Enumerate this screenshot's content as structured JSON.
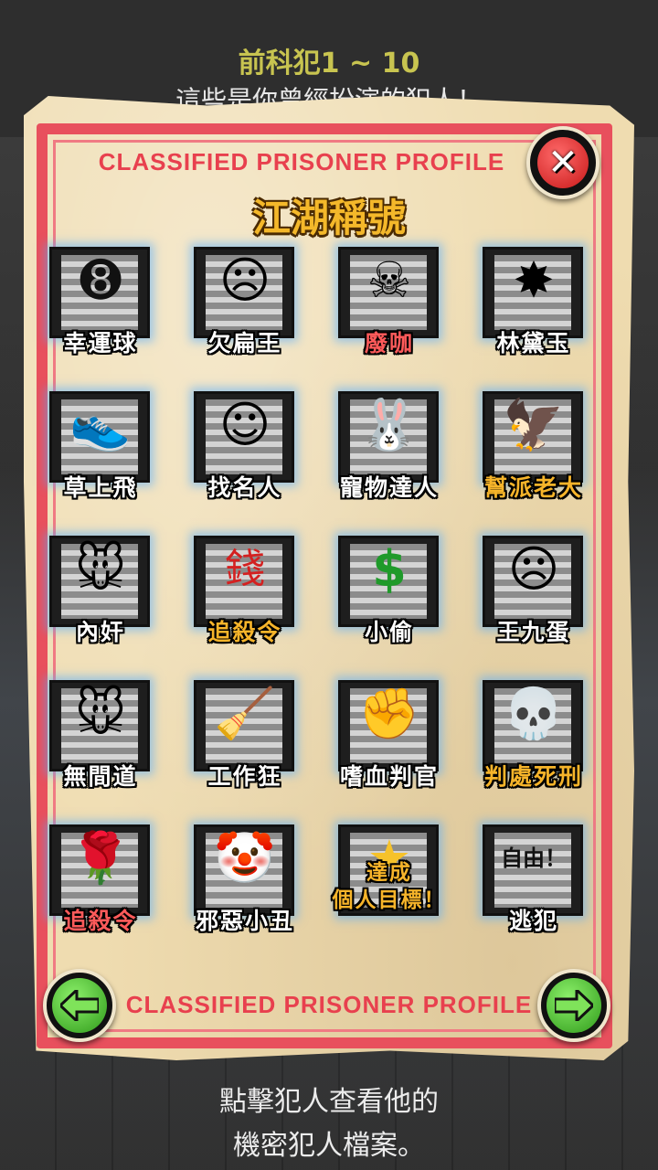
{
  "header": {
    "title": "前科犯1 ~ 10",
    "subtitle": "這些是你曾經扮演的犯人！"
  },
  "dialog": {
    "banner_top": "CLASSIFIED PRISONER PROFILE",
    "banner_bottom": "CLASSIFIED PRISONER PROFILE",
    "heading": "江湖稱號",
    "close_icon": "close-icon",
    "prev_icon": "arrow-left-icon",
    "next_icon": "arrow-right-icon"
  },
  "tiles": [
    {
      "label": "幸運球",
      "icon": "eight-ball-icon",
      "glyph": "➑",
      "color": "white"
    },
    {
      "label": "欠扁王",
      "icon": "prisoner-bald-icon",
      "glyph": "☹",
      "color": "white"
    },
    {
      "label": "廢咖",
      "icon": "bandaged-prisoner-icon",
      "glyph": "☠",
      "color": "red"
    },
    {
      "label": "林黛玉",
      "icon": "explosion-minus-icon",
      "glyph": "✸",
      "color": "white"
    },
    {
      "label": "草上飛",
      "icon": "sneaker-old-man-icon",
      "glyph": "👟",
      "color": "white"
    },
    {
      "label": "找名人",
      "icon": "celebrity-woman-icon",
      "glyph": "☺",
      "color": "white"
    },
    {
      "label": "寵物達人",
      "icon": "pet-animals-icon",
      "glyph": "🐰",
      "color": "white"
    },
    {
      "label": "幫派老大",
      "icon": "hanging-bird-icon",
      "glyph": "🦅",
      "color": "gold"
    },
    {
      "label": "內奸",
      "icon": "mouse-face-icon",
      "glyph": "🐭",
      "color": "white"
    },
    {
      "label": "追殺令",
      "icon": "money-seal-icon",
      "glyph": "錢",
      "color": "gold"
    },
    {
      "label": "小偷",
      "icon": "dollar-hand-icon",
      "glyph": "$",
      "color": "white"
    },
    {
      "label": "王九蛋",
      "icon": "prisoner-bald-icon",
      "glyph": "☹",
      "color": "white"
    },
    {
      "label": "無間道",
      "icon": "mouse-face-icon",
      "glyph": "🐭",
      "color": "white"
    },
    {
      "label": "工作狂",
      "icon": "soap-broom-icon",
      "glyph": "🧹",
      "color": "white"
    },
    {
      "label": "嗜血判官",
      "icon": "bloody-fist-icon",
      "glyph": "✊",
      "color": "white"
    },
    {
      "label": "判處死刑",
      "icon": "skeleton-cell-icon",
      "glyph": "💀",
      "color": "gold"
    },
    {
      "label": "追殺令",
      "icon": "gun-rose-icon",
      "glyph": "🌹",
      "color": "red"
    },
    {
      "label": "邪惡小丑",
      "icon": "jester-icon",
      "glyph": "🤡",
      "color": "white"
    },
    {
      "label": "達成\n個人目標！",
      "icon": "achievement-stars-icon",
      "glyph": "★",
      "color": "gold"
    },
    {
      "label": "逃犯",
      "icon": "escaping-legs-icon",
      "glyph": "自由！",
      "color": "white"
    }
  ],
  "footer": {
    "line1": "點擊犯人查看他的",
    "line2": "機密犯人檔案。"
  },
  "colors": {
    "frame_red": "#e8505d",
    "label_gold": "#f6b42a",
    "title_yellow": "#c8c450",
    "tile_glow": "#50aaff"
  }
}
